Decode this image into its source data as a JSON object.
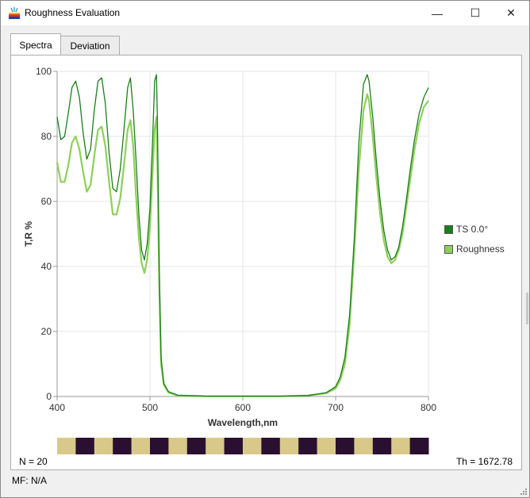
{
  "window": {
    "title": "Roughness Evaluation",
    "controls": {
      "minimize": "—",
      "maximize": "☐",
      "close": "✕"
    }
  },
  "tabs": [
    {
      "label": "Spectra",
      "active": true
    },
    {
      "label": "Deviation",
      "active": false
    }
  ],
  "legend": [
    {
      "label": "TS 0.0°",
      "color": "#1a7f1a"
    },
    {
      "label": "Roughness",
      "color": "#8fcf5a"
    }
  ],
  "layers": {
    "count_label": "N = 20",
    "thickness_label": "Th = 1672.78",
    "pattern_colors": [
      "#d8c98a",
      "#2a1030"
    ]
  },
  "status": {
    "mf_label": "MF: N/A"
  },
  "chart_data": {
    "type": "line",
    "xlabel": "Wavelength,nm",
    "ylabel": "T,R %",
    "xlim": [
      400,
      800
    ],
    "ylim": [
      0,
      100
    ],
    "x_ticks": [
      400,
      500,
      600,
      700,
      800
    ],
    "y_ticks": [
      0,
      20,
      40,
      60,
      80,
      100
    ],
    "grid": true,
    "legend_position": "right",
    "series": [
      {
        "name": "TS 0.0°",
        "color": "#1a7f1a",
        "x": [
          400,
          404,
          408,
          412,
          416,
          420,
          424,
          428,
          432,
          436,
          440,
          444,
          448,
          452,
          456,
          460,
          464,
          468,
          472,
          476,
          479,
          482,
          485,
          488,
          491,
          494,
          497,
          500,
          503,
          505,
          507,
          508,
          510,
          512,
          515,
          520,
          530,
          560,
          600,
          640,
          670,
          690,
          700,
          705,
          710,
          715,
          720,
          725,
          730,
          734,
          736,
          740,
          744,
          748,
          752,
          756,
          760,
          764,
          768,
          772,
          776,
          780,
          785,
          790,
          795,
          800
        ],
        "y": [
          86,
          79,
          80,
          87,
          95,
          97,
          92,
          81,
          73,
          76,
          88,
          97,
          98,
          90,
          75,
          64,
          63,
          70,
          82,
          95,
          98,
          88,
          73,
          56,
          45,
          42,
          47,
          58,
          80,
          97,
          99,
          85,
          40,
          12,
          4,
          1.5,
          0.4,
          0.1,
          0.1,
          0.1,
          0.3,
          1.2,
          3,
          6,
          12,
          25,
          48,
          78,
          96,
          99,
          97,
          86,
          72,
          60,
          51,
          45,
          42,
          43,
          46,
          52,
          60,
          69,
          79,
          87,
          92,
          95
        ]
      },
      {
        "name": "Roughness",
        "color": "#8fcf5a",
        "x": [
          400,
          404,
          408,
          412,
          416,
          420,
          424,
          428,
          432,
          436,
          440,
          444,
          448,
          452,
          456,
          460,
          464,
          468,
          472,
          476,
          479,
          482,
          485,
          488,
          491,
          494,
          497,
          500,
          503,
          505,
          507,
          508,
          510,
          512,
          515,
          520,
          530,
          560,
          600,
          640,
          670,
          690,
          700,
          705,
          710,
          715,
          720,
          725,
          730,
          734,
          736,
          740,
          744,
          748,
          752,
          756,
          760,
          764,
          768,
          772,
          776,
          780,
          785,
          790,
          795,
          800
        ],
        "y": [
          72,
          66,
          66,
          71,
          78,
          80,
          76,
          69,
          63,
          65,
          74,
          82,
          83,
          77,
          66,
          56,
          56,
          61,
          71,
          82,
          85,
          77,
          62,
          49,
          41,
          38,
          42,
          52,
          70,
          82,
          86,
          72,
          34,
          10,
          3.5,
          1.2,
          0.3,
          0.1,
          0.1,
          0.1,
          0.3,
          1,
          2.5,
          5,
          10,
          22,
          44,
          70,
          88,
          93,
          91,
          80,
          67,
          56,
          48,
          43,
          41,
          42,
          45,
          50,
          58,
          66,
          76,
          84,
          89,
          91
        ]
      }
    ]
  }
}
